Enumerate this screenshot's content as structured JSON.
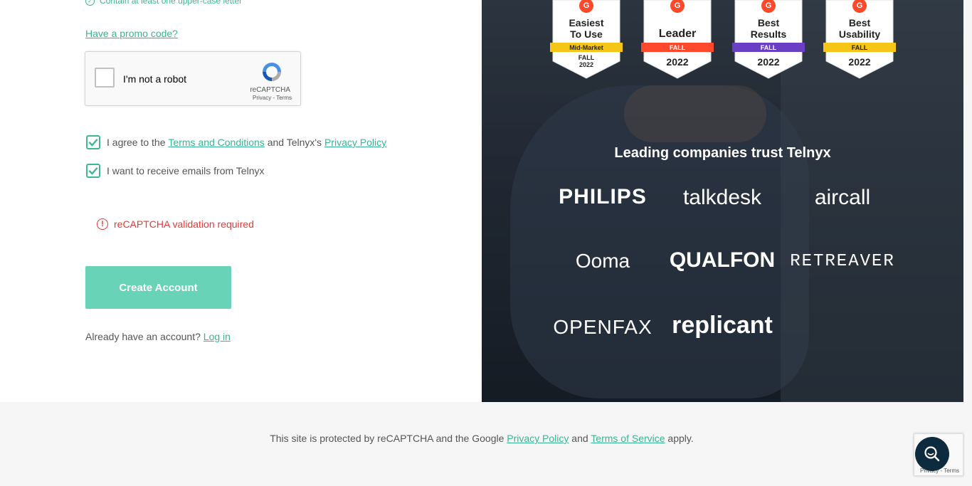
{
  "form": {
    "password_rule": "Contain at least one upper-case letter",
    "promo_link": "Have a promo code?",
    "recaptcha": {
      "label": "I'm not a robot",
      "brand": "reCAPTCHA",
      "links": "Privacy - Terms"
    },
    "terms": {
      "prefix": "I agree to the ",
      "terms_link": "Terms and Conditions",
      "middle": " and Telnyx's ",
      "privacy_link": "Privacy Policy",
      "checked": true
    },
    "emails": {
      "label": "I want to receive emails from Telnyx",
      "checked": true
    },
    "error": "reCAPTCHA validation required",
    "submit_label": "Create Account",
    "login_prompt": "Already have an account? ",
    "login_link": "Log in"
  },
  "promo": {
    "badges": [
      {
        "title_line1": "Easiest",
        "title_line2": "To Use",
        "ribbon": "Mid-Market",
        "season": "FALL",
        "year": "2022",
        "ribbon_color": "#f5c518"
      },
      {
        "title_line1": "",
        "title_line2": "Leader",
        "ribbon": "FALL",
        "season": "",
        "year": "2022",
        "ribbon_color": "#ff492c"
      },
      {
        "title_line1": "Best",
        "title_line2": "Results",
        "ribbon": "FALL",
        "season": "",
        "year": "2022",
        "ribbon_color": "#6a3fc4"
      },
      {
        "title_line1": "Best",
        "title_line2": "Usability",
        "ribbon": "FALL",
        "season": "",
        "year": "2022",
        "ribbon_color": "#f5c518"
      }
    ],
    "badge_logo": "G",
    "trust_title": "Leading companies trust Telnyx",
    "logos": [
      "PHILIPS",
      "talkdesk",
      "aircall",
      "Ooma",
      "QUALFON",
      "RETREAVER",
      "OPENFAX",
      "replicant"
    ]
  },
  "footer": {
    "prefix": "This site is protected by reCAPTCHA and the Google ",
    "privacy_link": "Privacy Policy",
    "middle": " and ",
    "terms_link": "Terms of Service",
    "suffix": " apply."
  },
  "recaptcha_badge": {
    "links": "Privacy - Terms"
  },
  "colors": {
    "accent": "#3cb893",
    "button": "#68d3b6",
    "error": "#e53935",
    "help_button": "#0d2b3e"
  }
}
